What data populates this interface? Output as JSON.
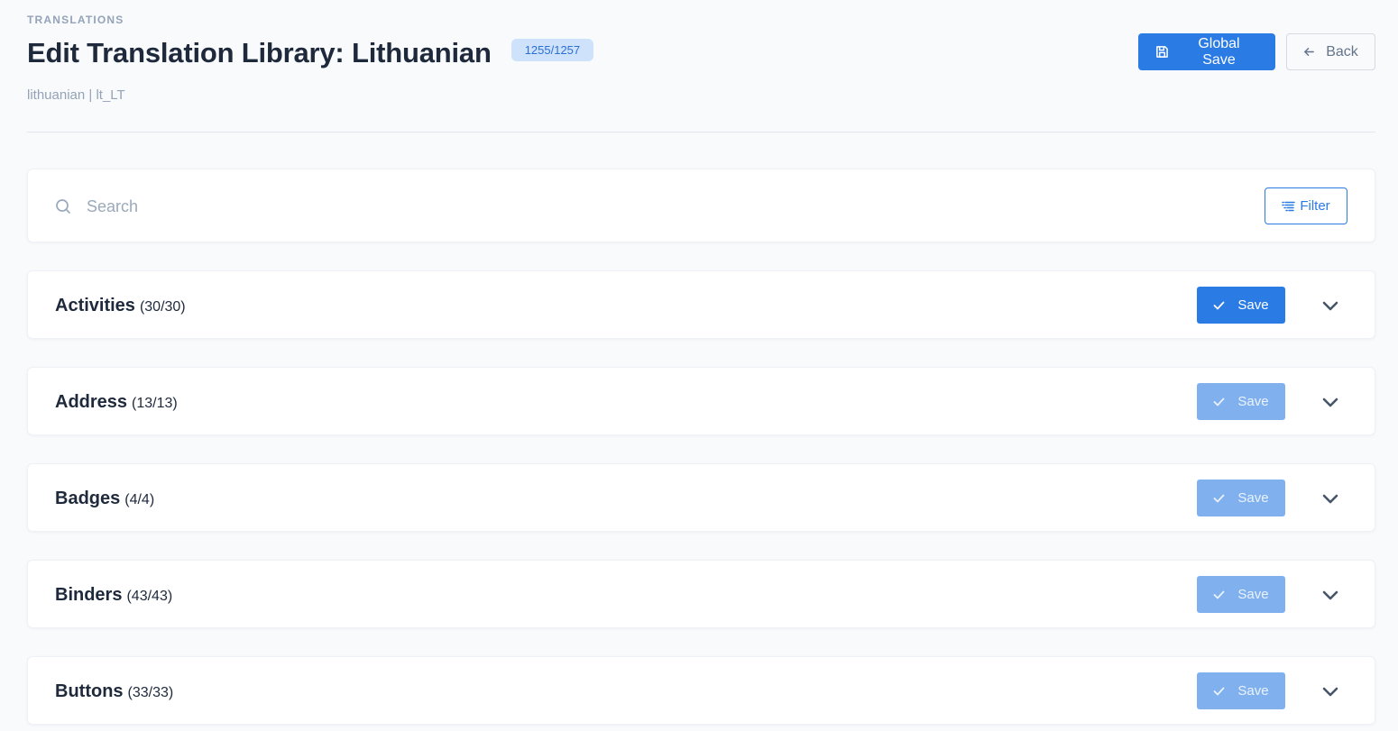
{
  "header": {
    "eyebrow": "TRANSLATIONS",
    "title": "Edit Translation Library: Lithuanian",
    "progress_badge": "1255/1257",
    "subtitle": "lithuanian | lt_LT",
    "global_save_label": "Global Save",
    "back_label": "Back"
  },
  "search": {
    "placeholder": "Search",
    "value": "",
    "filter_label": "Filter"
  },
  "sections": [
    {
      "name": "Activities",
      "count": "(30/30)",
      "save_label": "Save",
      "save_enabled": true
    },
    {
      "name": "Address",
      "count": "(13/13)",
      "save_label": "Save",
      "save_enabled": false
    },
    {
      "name": "Badges",
      "count": "(4/4)",
      "save_label": "Save",
      "save_enabled": false
    },
    {
      "name": "Binders",
      "count": "(43/43)",
      "save_label": "Save",
      "save_enabled": false
    },
    {
      "name": "Buttons",
      "count": "(33/33)",
      "save_label": "Save",
      "save_enabled": false
    }
  ],
  "colors": {
    "accent": "#2b7be5",
    "accent_disabled": "#80b1ee",
    "badge_bg": "#cfe2fb",
    "page_bg": "#f8fafc"
  },
  "icons": {
    "global_save": "floppy-disk-icon",
    "back": "arrow-left-icon",
    "search": "search-icon",
    "filter": "filter-lines-icon",
    "save": "check-icon",
    "expand": "chevron-down-icon"
  }
}
